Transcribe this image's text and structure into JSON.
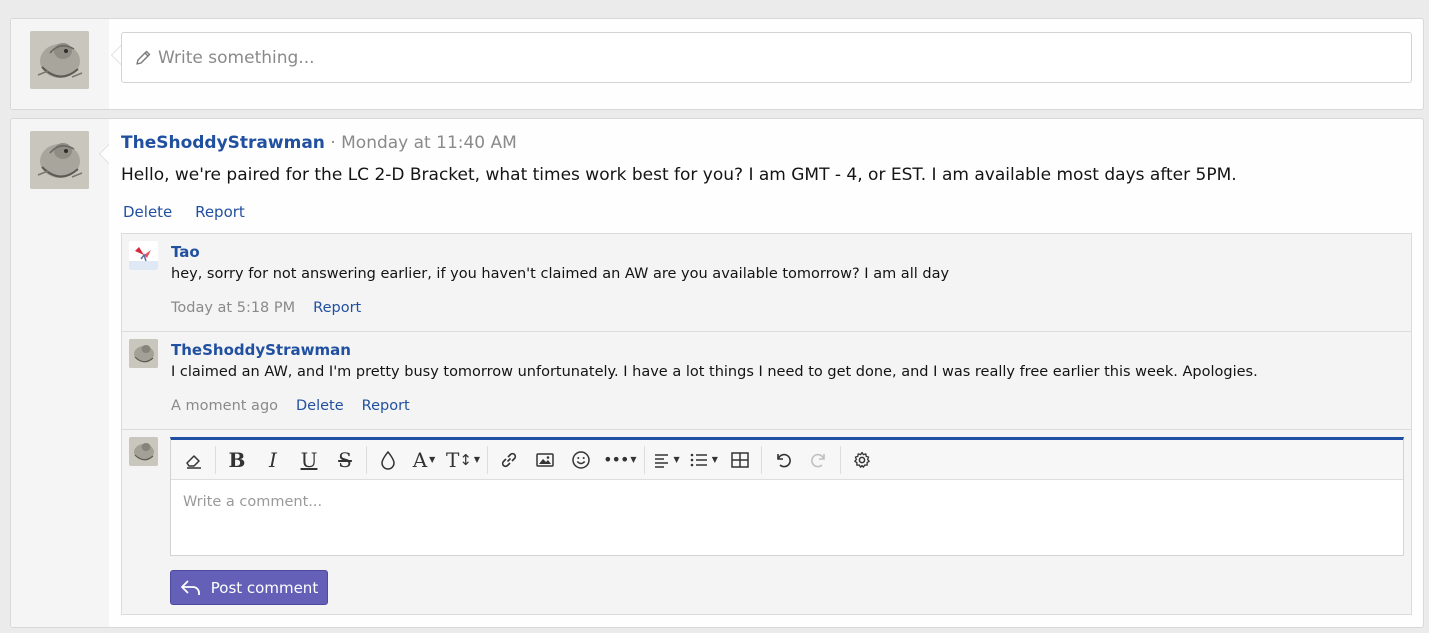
{
  "status": {
    "placeholder": "Write something..."
  },
  "post": {
    "author": "TheShoddyStrawman",
    "separator": " · ",
    "time": "Monday at 11:40 AM",
    "body": "Hello, we're paired for the LC 2-D Bracket, what times work best for you? I am GMT - 4, or EST. I am available most days after 5PM.",
    "actions": [
      "Delete",
      "Report"
    ]
  },
  "comments": [
    {
      "author": "Tao",
      "text": "hey, sorry for not answering earlier, if you haven't claimed an AW are you available tomorrow? I am all day",
      "time": "Today at 5:18 PM",
      "actions": [
        "Report"
      ]
    },
    {
      "author": "TheShoddyStrawman",
      "text": "I claimed an AW, and I'm pretty busy tomorrow unfortunately. I have a lot things I need to get done, and I was really free earlier this week. Apologies.",
      "time": "A moment ago",
      "actions": [
        "Delete",
        "Report"
      ]
    }
  ],
  "editor": {
    "placeholder": "Write a comment...",
    "toolbar": [
      "eraser-icon",
      "bold",
      "italic",
      "underline",
      "strikethrough",
      "color-drop-icon",
      "font-family",
      "font-size",
      "link-icon",
      "image-icon",
      "smiley-icon",
      "more-icon",
      "align-icon",
      "list-icon",
      "table-icon",
      "undo-icon",
      "redo-icon",
      "settings-gear-icon"
    ],
    "bold": "B",
    "italic": "I",
    "underline": "U",
    "strike": "S",
    "font": "A",
    "size": "T",
    "submit_label": "Post comment"
  },
  "colors": {
    "link": "#2150a0",
    "button": "#6460b8",
    "editor_accent": "#1e4fa5",
    "page_bg": "#ebebeb"
  }
}
